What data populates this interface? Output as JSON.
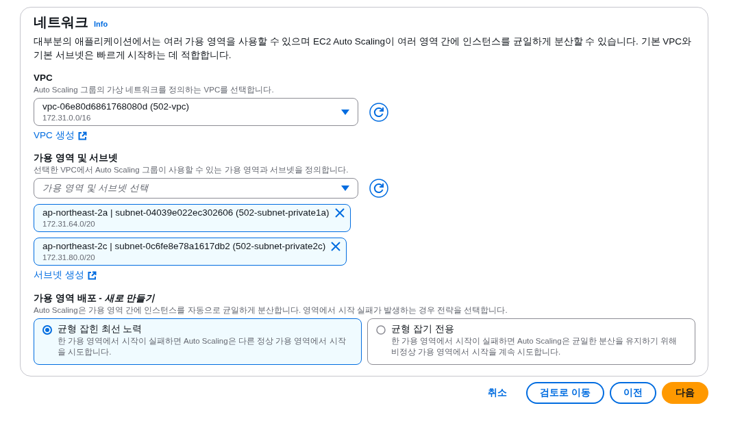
{
  "section": {
    "title": "네트워크",
    "info_link": "Info",
    "description": "대부분의 애플리케이션에서는 여러 가용 영역을 사용할 수 있으며 EC2 Auto Scaling이 여러 영역 간에 인스턴스를 균일하게 분산할 수 있습니다. 기본 VPC와 기본 서브넷은 빠르게 시작하는 데 적합합니다."
  },
  "vpc": {
    "label": "VPC",
    "description": "Auto Scaling 그룹의 가상 네트워크를 정의하는 VPC를 선택합니다.",
    "value": "vpc-06e80d6861768080d (502-vpc)",
    "value_detail": "172.31.0.0/16",
    "create_link": "VPC 생성"
  },
  "subnets": {
    "label": "가용 영역 및 서브넷",
    "description": "선택한 VPC에서 Auto Scaling 그룹이 사용할 수 있는 가용 영역과 서브넷을 정의합니다.",
    "placeholder": "가용 영역 및 서브넷 선택",
    "tokens": [
      {
        "label": "ap-northeast-2a | subnet-04039e022ec302606 (502-subnet-private1a)",
        "detail": "172.31.64.0/20"
      },
      {
        "label": "ap-northeast-2c | subnet-0c6fe8e78a1617db2 (502-subnet-private2c)",
        "detail": "172.31.80.0/20"
      }
    ],
    "create_link": "서브넷 생성"
  },
  "distribution": {
    "label": "가용 영역 배포 - *새로 만들기*",
    "description": "Auto Scaling은 가용 영역 간에 인스턴스를 자동으로 균일하게 분산합니다. 영역에서 시작 실패가 발생하는 경우 전략을 선택합니다.",
    "options": [
      {
        "title": "균형 잡힌 최선 노력",
        "description": "한 가용 영역에서 시작이 실패하면 Auto Scaling은 다른 정상 가용 영역에서 시작을 시도합니다.",
        "selected": true
      },
      {
        "title": "균형 잡기 전용",
        "description": "한 가용 영역에서 시작이 실패하면 Auto Scaling은 균일한 분산을 유지하기 위해 비정상 가용 영역에서 시작을 계속 시도합니다.",
        "selected": false
      }
    ]
  },
  "footer_buttons": [
    {
      "label": "취소",
      "kind": "link"
    },
    {
      "label": "검토로 이동",
      "kind": "secondary"
    },
    {
      "label": "이전",
      "kind": "secondary"
    },
    {
      "label": "다음",
      "kind": "primary"
    }
  ]
}
